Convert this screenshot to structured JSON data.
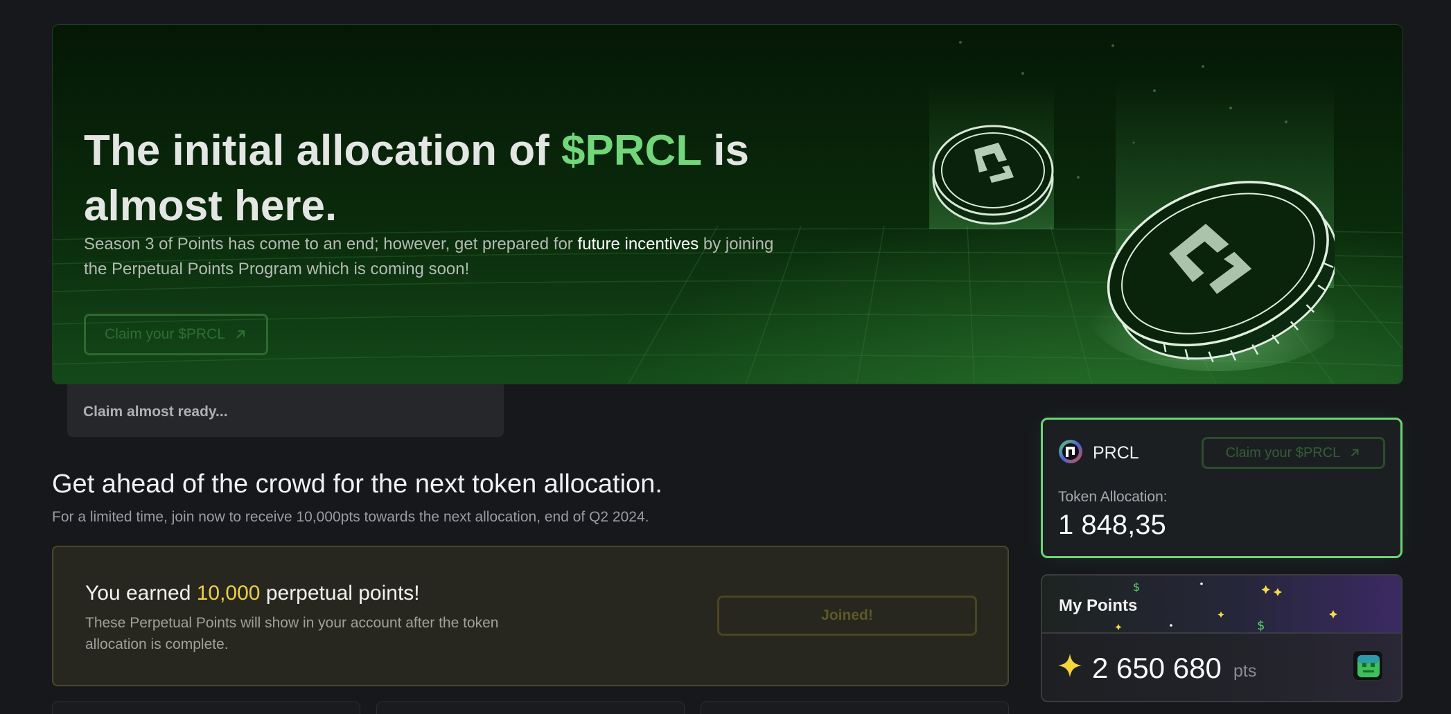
{
  "hero": {
    "title_part1": "The initial allocation of ",
    "title_accent": "$PRCL",
    "title_part2": " is almost here.",
    "desc_part1": "Season 3 of Points has come to an end; however, get prepared for ",
    "desc_highlight": "future incentives",
    "desc_part2": " by joining the Perpetual Points Program which is coming soon!",
    "claim_label": "Claim your $PRCL"
  },
  "ready_tab": {
    "label": "Claim almost ready..."
  },
  "ahead": {
    "title": "Get ahead of the crowd for the next token allocation.",
    "subtitle": "For a limited time, join now to receive 10,000pts towards the next allocation, end of Q2 2024."
  },
  "earned": {
    "title_part1": "You earned ",
    "title_amount": "10,000",
    "title_part2": " perpetual points!",
    "desc": "These Perpetual Points will show in your account after the token allocation is complete.",
    "button_label": "Joined!"
  },
  "prcl_card": {
    "token_name": "PRCL",
    "claim_label": "Claim your $PRCL",
    "allocation_label": "Token Allocation:",
    "allocation_value": "1 848,35"
  },
  "points_card": {
    "label": "My Points",
    "value": "2 650 680",
    "unit": "pts"
  },
  "colors": {
    "accent_green": "#72d67b",
    "accent_yellow": "#ead04a",
    "background": "#17181c"
  },
  "icons": {
    "external_arrow": "arrow-up-right-icon",
    "star": "sparkle-star-icon"
  }
}
